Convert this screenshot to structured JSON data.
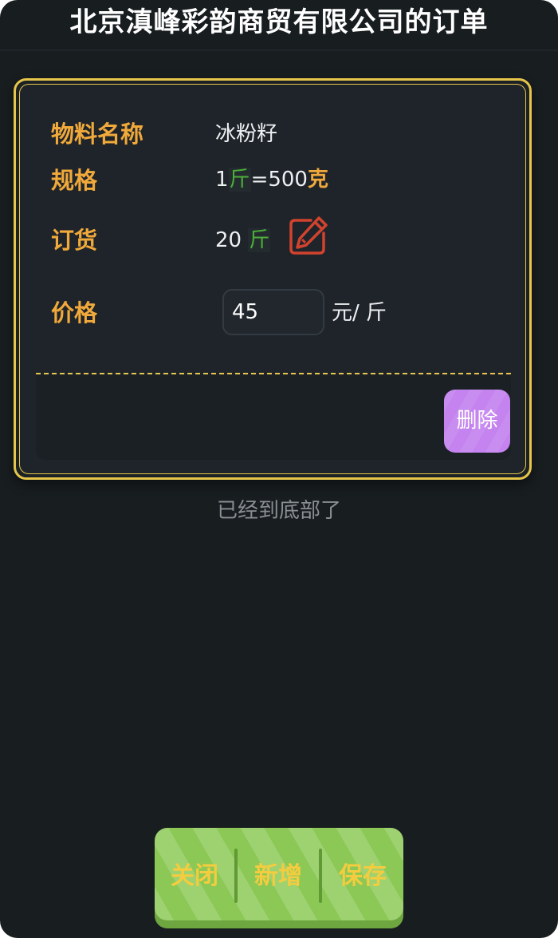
{
  "header": {
    "title": "北京滇峰彩韵商贸有限公司的订单"
  },
  "order_item": {
    "material_label": "物料名称",
    "material_name": "冰粉籽",
    "spec_label": "规格",
    "spec_qty": "1",
    "spec_unit": "斤",
    "spec_equals": "=500",
    "spec_gram_unit": "克",
    "order_label": "订货",
    "order_qty": "20",
    "order_unit": "斤",
    "edit_icon": "edit-pencil-icon",
    "price_label": "价格",
    "price_value": "45",
    "price_unit": "元/ 斤",
    "delete_label": "删除"
  },
  "list_end_text": "已经到底部了",
  "toolbar": {
    "close_label": "关闭",
    "add_label": "新增",
    "save_label": "保存"
  },
  "colors": {
    "background": "#181d20",
    "card_border": "#e6c64a",
    "label_orange": "#f0a93a",
    "unit_green": "#4caf38",
    "delete_purple": "#c483ef",
    "toolbar_green": "#8bc855",
    "toolbar_text": "#f4cc3f",
    "edit_icon_red": "#d1432e"
  }
}
